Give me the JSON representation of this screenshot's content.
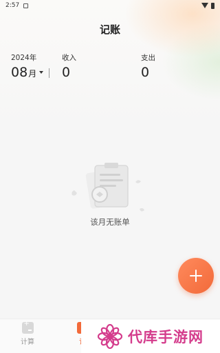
{
  "status_bar": {
    "time": "2:57"
  },
  "header": {
    "title": "记账"
  },
  "summary": {
    "year": "2024年",
    "month": "08",
    "month_unit": "月",
    "income_label": "收入",
    "income_value": "0",
    "expense_label": "支出",
    "expense_value": "0"
  },
  "empty_state": {
    "message": "该月无账单"
  },
  "bottom_nav": {
    "items": [
      {
        "label": "计算",
        "icon": "calculator-icon",
        "active": false
      },
      {
        "label": "记",
        "icon": "ledger-icon",
        "active": true
      }
    ]
  },
  "watermark": {
    "text": "代库手游网"
  },
  "colors": {
    "accent": "#f26a3a",
    "watermark": "#d43c8c"
  }
}
